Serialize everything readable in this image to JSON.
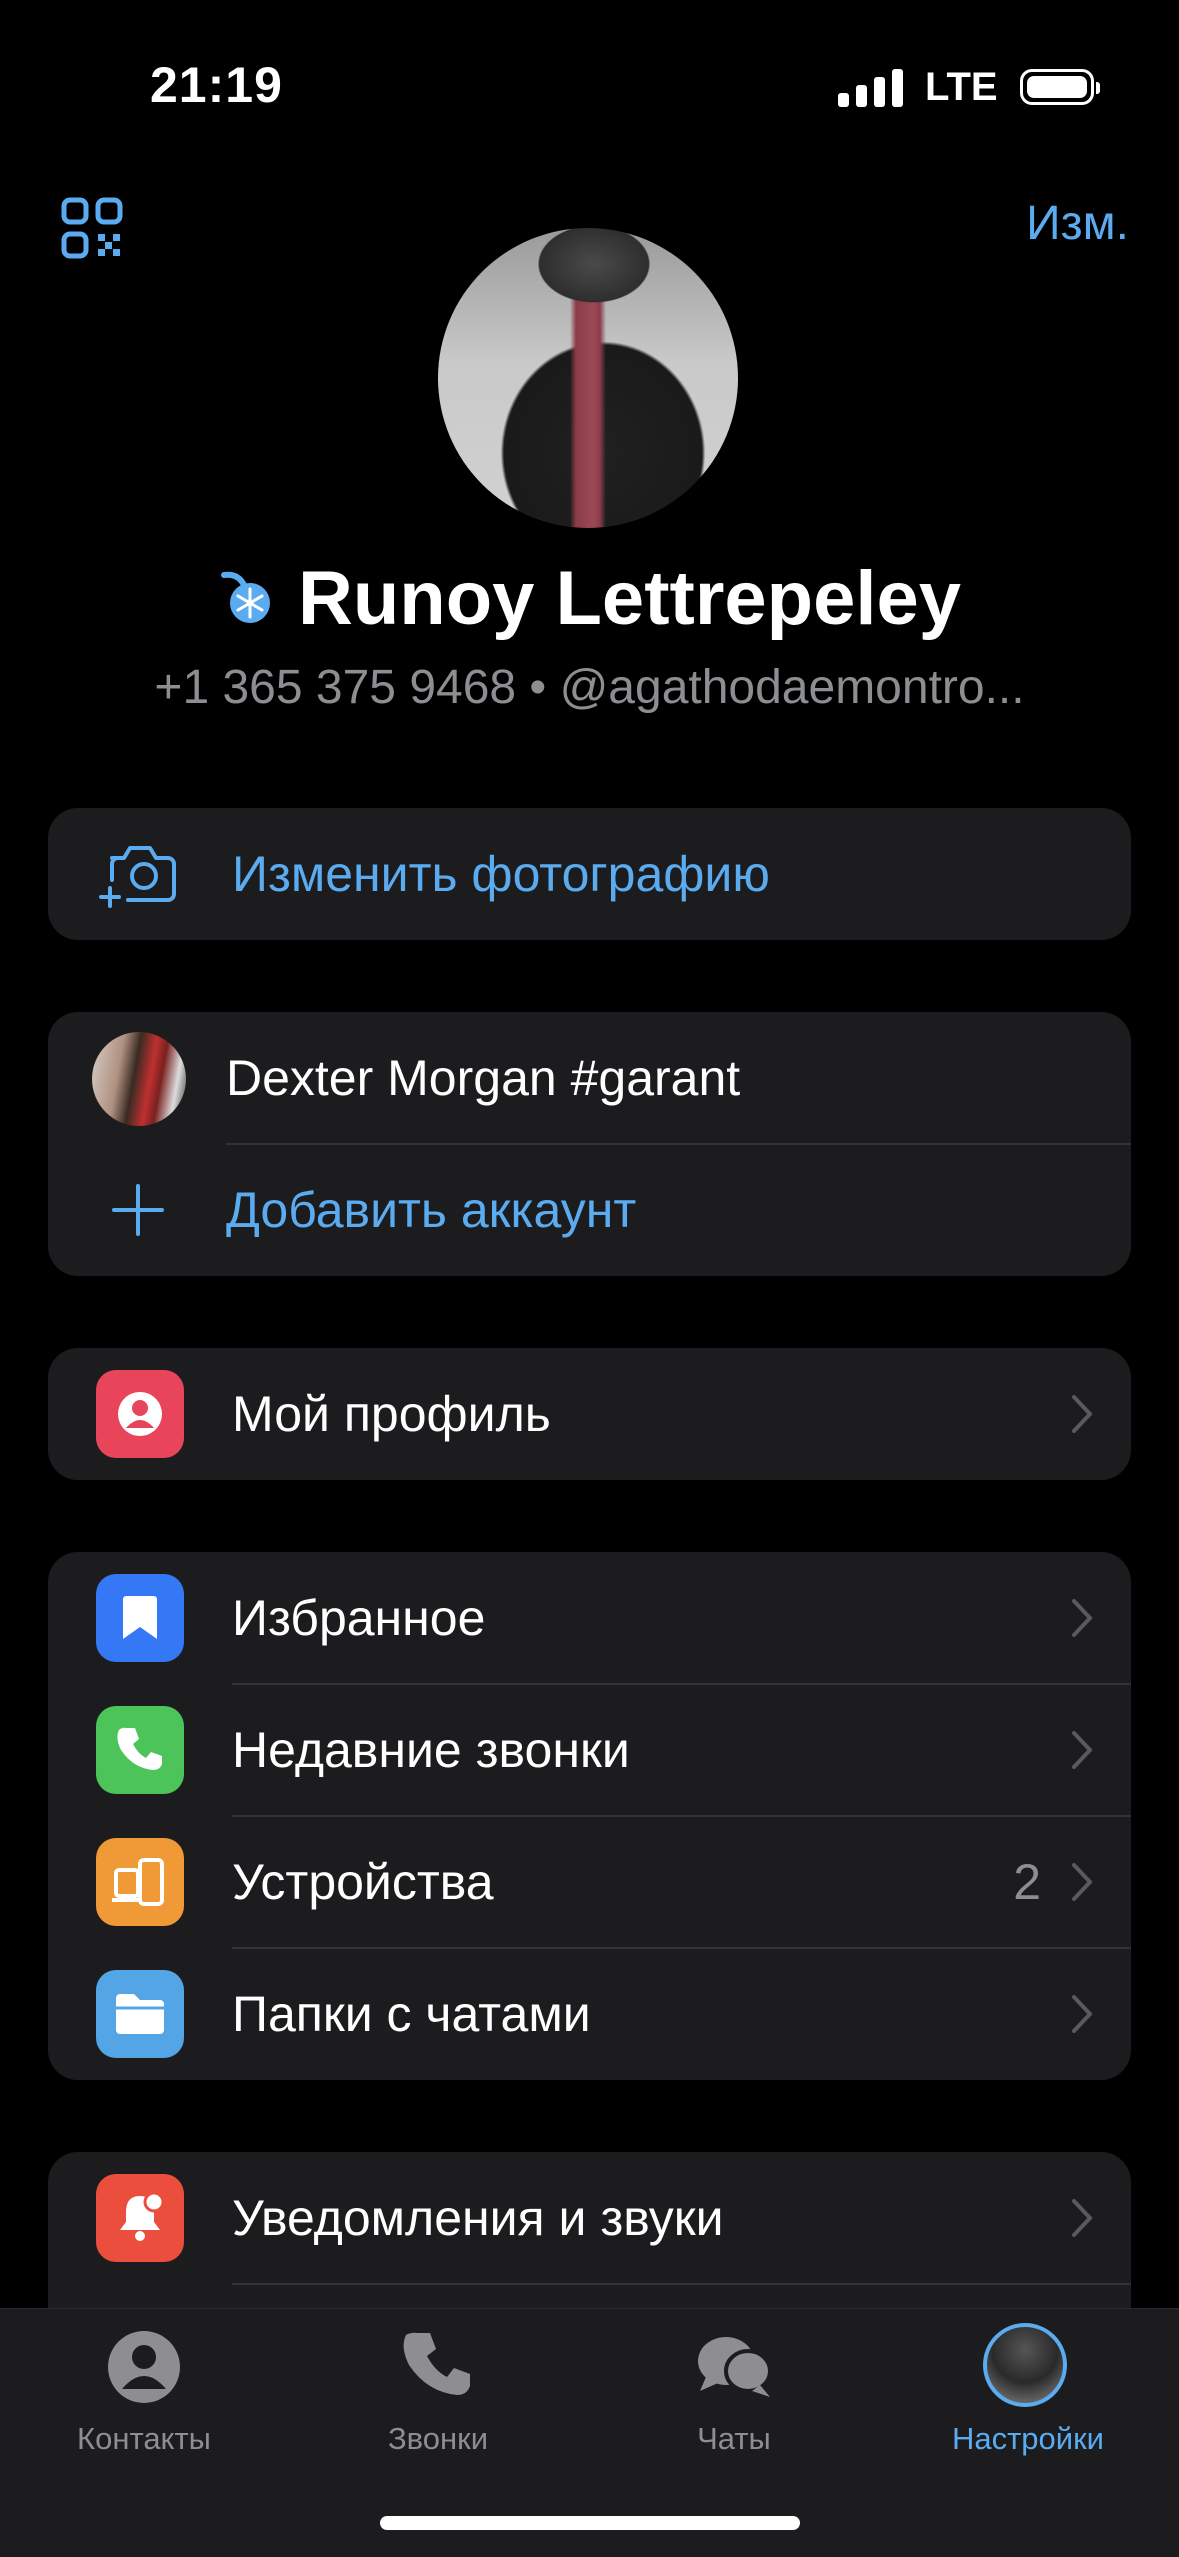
{
  "status_bar": {
    "time": "21:19",
    "network": "LTE"
  },
  "header": {
    "edit_label": "Изм."
  },
  "profile": {
    "name": "Runoy Lettrepeley",
    "subtitle": "+1 365 375 9468 • @agathodaemontro..."
  },
  "photo_card": {
    "change_photo_label": "Изменить фотографию"
  },
  "accounts_card": {
    "account_name": "Dexter Morgan #garant",
    "add_account_label": "Добавить аккаунт"
  },
  "profile_card": {
    "my_profile_label": "Мой профиль"
  },
  "main_menu": {
    "items": [
      {
        "label": "Избранное",
        "icon": "bookmark-icon",
        "color": "#3478f6"
      },
      {
        "label": "Недавние звонки",
        "icon": "phone-icon",
        "color": "#4cc45a"
      },
      {
        "label": "Устройства",
        "icon": "devices-icon",
        "color": "#f09a37",
        "badge": "2"
      },
      {
        "label": "Папки с чатами",
        "icon": "folder-icon",
        "color": "#54a5e6"
      }
    ]
  },
  "notifications_card": {
    "label": "Уведомления и звуки",
    "color": "#eb4e3d"
  },
  "tabbar": {
    "tabs": [
      {
        "label": "Контакты"
      },
      {
        "label": "Звонки"
      },
      {
        "label": "Чаты"
      },
      {
        "label": "Настройки",
        "active": true
      }
    ]
  },
  "colors": {
    "accent": "#5aabf0",
    "background": "#000000",
    "card": "#1c1c1e"
  }
}
